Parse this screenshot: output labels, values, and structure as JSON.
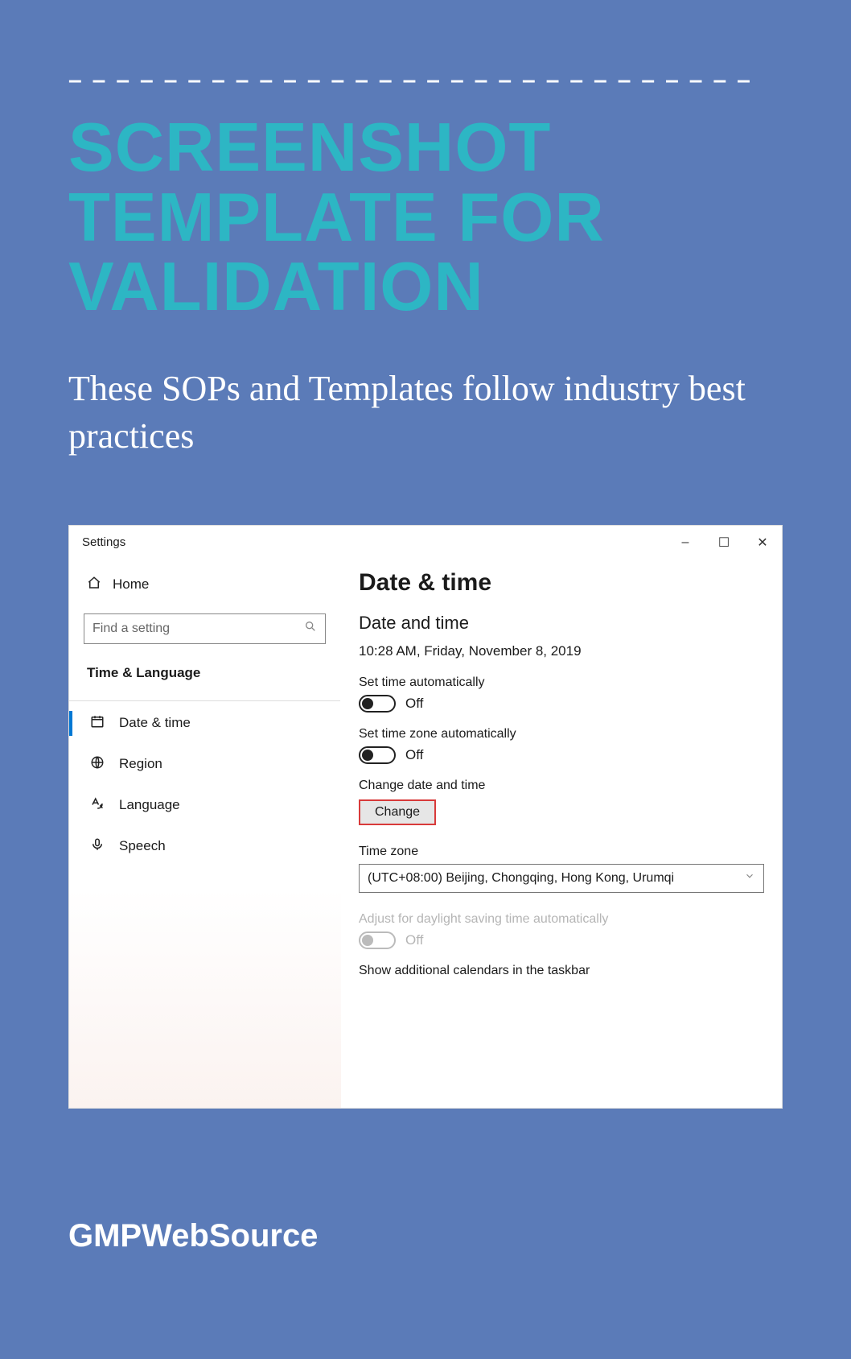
{
  "header": {
    "dashes": "–––––––––––––––––––––––––––––",
    "title_l1": "SCREENSHOT",
    "title_l2": "TEMPLATE FOR",
    "title_l3": "VALIDATION",
    "subtitle": "These SOPs and Templates follow industry best practices"
  },
  "footer": {
    "brand": "GMPWebSource"
  },
  "settings": {
    "app_title": "Settings",
    "home": "Home",
    "search_placeholder": "Find a setting",
    "category": "Time & Language",
    "nav": {
      "date_time": "Date & time",
      "region": "Region",
      "language": "Language",
      "speech": "Speech"
    },
    "main": {
      "heading": "Date & time",
      "subheading": "Date and time",
      "current": "10:28 AM, Friday, November 8, 2019",
      "set_time_auto_label": "Set time automatically",
      "set_time_auto_value": "Off",
      "set_tz_auto_label": "Set time zone automatically",
      "set_tz_auto_value": "Off",
      "change_label": "Change date and time",
      "change_button": "Change",
      "tz_label": "Time zone",
      "tz_value": "(UTC+08:00) Beijing, Chongqing, Hong Kong, Urumqi",
      "dst_label": "Adjust for daylight saving time automatically",
      "dst_value": "Off",
      "extra": "Show additional calendars in the taskbar"
    }
  }
}
